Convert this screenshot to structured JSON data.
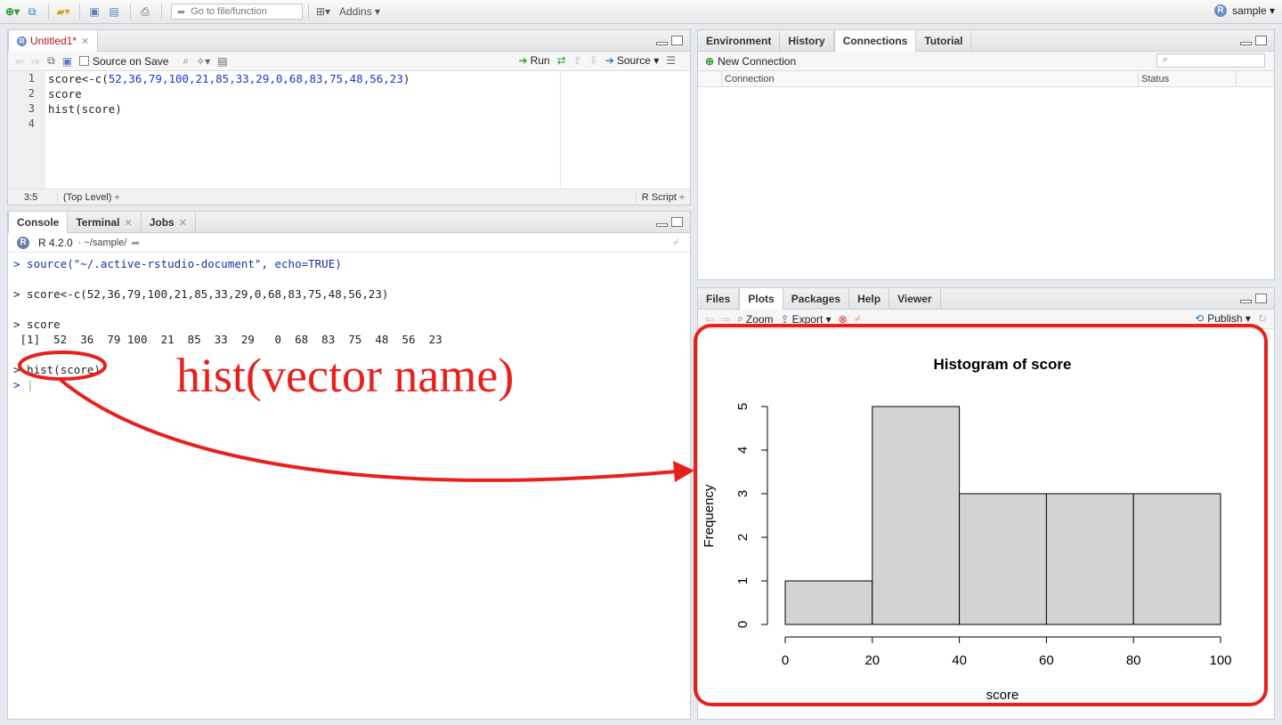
{
  "topbar": {
    "goto_placeholder": "Go to file/function",
    "addins_label": "Addins",
    "project_label": "sample"
  },
  "source": {
    "tab_label": "Untitled1*",
    "source_on_save_label": "Source on Save",
    "run_label": "Run",
    "source_label": "Source",
    "lines": [
      "1",
      "2",
      "3",
      "4"
    ],
    "code": {
      "line1_prefix": "score<-c(",
      "line1_values": "52,36,79,100,21,85,33,29,0,68,83,75,48,56,23",
      "line1_suffix": ")",
      "line2": "score",
      "line3": "hist(score)",
      "line4": ""
    },
    "status": {
      "position": "3:5",
      "scope": "(Top Level) ÷",
      "filetype": "R Script ÷"
    }
  },
  "console": {
    "tabs": [
      "Console",
      "Terminal",
      "Jobs"
    ],
    "version_label": "R 4.2.0",
    "path_label": "· ~/sample/",
    "lines": {
      "l1": "> source(\"~/.active-rstudio-document\", echo=TRUE)",
      "l2": "> score<-c(52,36,79,100,21,85,33,29,0,68,83,75,48,56,23)",
      "l3": "> score",
      "l4": " [1]  52  36  79 100  21  85  33  29   0  68  83  75  48  56  23",
      "l5_prompt": ">",
      "l5_cmd": "hist(score)",
      "l6_prompt": ">"
    }
  },
  "environment": {
    "tabs": [
      "Environment",
      "History",
      "Connections",
      "Tutorial"
    ],
    "new_connection_label": "New Connection",
    "col_connection": "Connection",
    "col_status": "Status"
  },
  "plots": {
    "tabs": [
      "Files",
      "Plots",
      "Packages",
      "Help",
      "Viewer"
    ],
    "zoom_label": "Zoom",
    "export_label": "Export",
    "publish_label": "Publish"
  },
  "annotation": {
    "text": "hist(vector name)",
    "color": "#e8201c"
  },
  "chart_data": {
    "type": "bar",
    "title": "Histogram of score",
    "xlabel": "score",
    "ylabel": "Frequency",
    "bins": [
      [
        0,
        20
      ],
      [
        20,
        40
      ],
      [
        40,
        60
      ],
      [
        60,
        80
      ],
      [
        80,
        100
      ]
    ],
    "values": [
      1,
      5,
      3,
      3,
      3
    ],
    "xticks": [
      "0",
      "20",
      "40",
      "60",
      "80",
      "100"
    ],
    "yticks": [
      "0",
      "1",
      "2",
      "3",
      "4",
      "5"
    ],
    "xlim": [
      0,
      100
    ],
    "ylim": [
      0,
      5
    ],
    "bar_color": "#d3d3d3"
  }
}
